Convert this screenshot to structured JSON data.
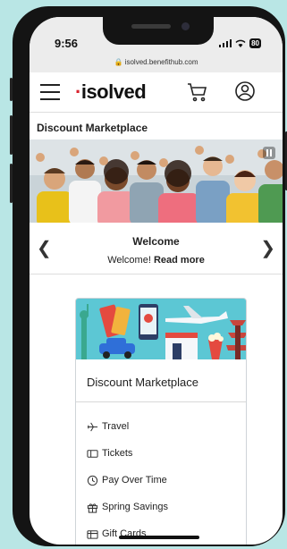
{
  "status_bar": {
    "time": "9:56",
    "battery": "80",
    "url": "isolved.benefithub.com"
  },
  "header": {
    "logo_dot": "·",
    "logo_text": "isolved"
  },
  "page": {
    "title": "Discount Marketplace"
  },
  "carousel": {
    "title": "Welcome",
    "body": "Welcome!",
    "link": "Read more"
  },
  "card": {
    "title": "Discount Marketplace",
    "items": [
      "Travel",
      "Tickets",
      "Pay Over Time",
      "Spring Savings",
      "Gift Cards"
    ]
  },
  "colors": {
    "brand_red": "#d9232e",
    "card_banner": "#5cc7d4",
    "background": "#b9e6e5"
  }
}
